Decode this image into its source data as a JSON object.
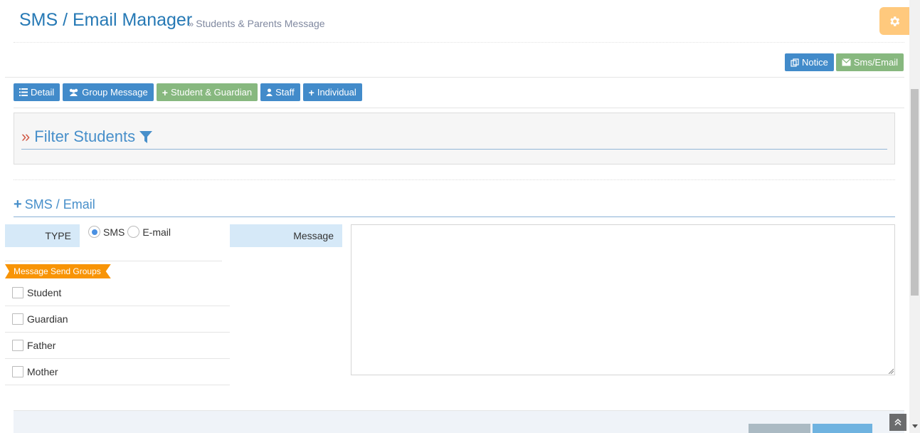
{
  "header": {
    "title": "SMS / Email Manager",
    "subtitle": "Students & Parents Message"
  },
  "top_actions": {
    "notice_label": "Notice",
    "sms_email_label": "Sms/Email"
  },
  "tabs": [
    {
      "label": "Detail",
      "icon": "list-icon"
    },
    {
      "label": "Group Message",
      "icon": "users-icon"
    },
    {
      "label": "Student & Guardian",
      "icon": "plus-icon"
    },
    {
      "label": "Staff",
      "icon": "user-icon"
    },
    {
      "label": "Individual",
      "icon": "plus-icon"
    }
  ],
  "filter": {
    "title": "Filter Students"
  },
  "form": {
    "section_title": "SMS / Email",
    "type_label": "TYPE",
    "type_options": [
      "SMS",
      "E-mail"
    ],
    "type_selected": "SMS",
    "groups_label": "Message Send Groups",
    "groups": [
      "Student",
      "Guardian",
      "Father",
      "Mother"
    ],
    "message_label": "Message",
    "message_value": ""
  },
  "colors": {
    "title_blue": "#2679b5",
    "btn_blue": "#428bca",
    "btn_green": "#87b87f",
    "label_bg": "#d6e9f8",
    "ribbon_orange": "#f89406",
    "settings_orange": "#ffb752"
  }
}
